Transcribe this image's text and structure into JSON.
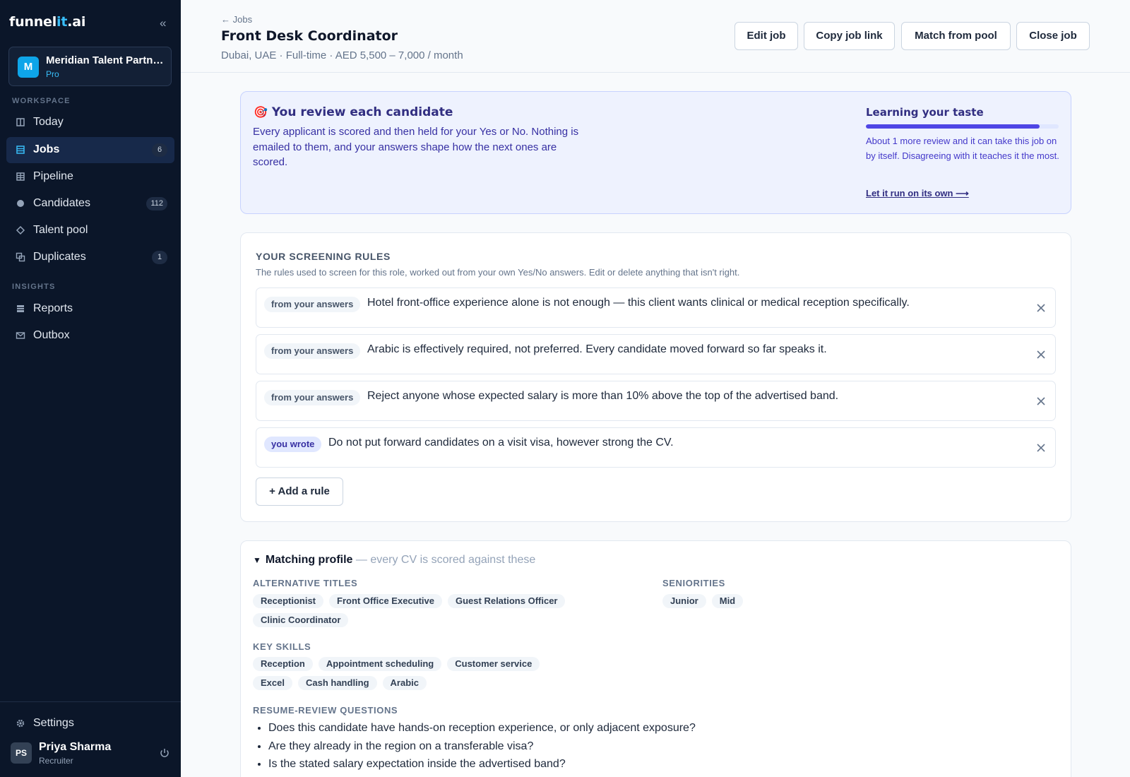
{
  "sidebar": {
    "logo": {
      "part1": "funnel",
      "part2": "it",
      "part3": ".ai"
    },
    "org": {
      "initial": "M",
      "name": "Meridian Talent Partners",
      "plan": "Pro"
    },
    "sections": {
      "workspace": "WORKSPACE",
      "insights": "INSIGHTS"
    },
    "items": [
      {
        "label": "Today",
        "icon": "today-icon"
      },
      {
        "label": "Jobs",
        "icon": "jobs-icon",
        "count": "6",
        "active": true
      },
      {
        "label": "Pipeline",
        "icon": "pipeline-icon"
      },
      {
        "label": "Candidates",
        "icon": "candidates-icon",
        "count": "112"
      },
      {
        "label": "Talent pool",
        "icon": "talent-pool-icon"
      },
      {
        "label": "Duplicates",
        "icon": "duplicates-icon",
        "count": "1"
      },
      {
        "label": "Reports",
        "icon": "reports-icon"
      },
      {
        "label": "Outbox",
        "icon": "outbox-icon"
      }
    ],
    "settings": "Settings",
    "user": {
      "initials": "PS",
      "name": "Priya Sharma",
      "role": "Recruiter"
    }
  },
  "header": {
    "breadcrumb": "← Jobs",
    "title": "Front Desk Coordinator",
    "subtitle": "Dubai, UAE · Full-time · AED 5,500 – 7,000 / month",
    "buttons": {
      "edit": "Edit job",
      "copy": "Copy job link",
      "match": "Match from pool",
      "close": "Close job"
    }
  },
  "banner": {
    "emoji": "🎯",
    "title": "You review each candidate",
    "text": "Every applicant is scored and then held for your Yes or No. Nothing is emailed to them, and your answers shape how the next ones are scored.",
    "learning_title": "Learning your taste",
    "learning_progress": 0.9,
    "learning_text": "About 1 more review and it can take this job on by itself. Disagreeing with it teaches it the most.",
    "learning_link": "Let it run on its own ⟶"
  },
  "rules": {
    "title": "YOUR SCREENING RULES",
    "description": "The rules used to screen for this role, worked out from your own Yes/No answers. Edit or delete anything that isn't right.",
    "items": [
      {
        "tag": "from your answers",
        "text": "Hotel front-office experience alone is not enough — this client wants clinical or medical reception specifically."
      },
      {
        "tag": "from your answers",
        "text": "Arabic is effectively required, not preferred. Every candidate moved forward so far speaks it."
      },
      {
        "tag": "from your answers",
        "text": "Reject anyone whose expected salary is more than 10% above the top of the advertised band."
      },
      {
        "tag": "you wrote",
        "text": "Do not put forward candidates on a visit visa, however strong the CV."
      }
    ],
    "add_label": "+ Add a rule"
  },
  "profile": {
    "toggle": "▼",
    "heading": "Matching profile",
    "heading_suffix": " — every CV is scored against these",
    "alt_titles_label": "ALTERNATIVE TITLES",
    "alt_titles": [
      "Receptionist",
      "Front Office Executive",
      "Guest Relations Officer",
      "Clinic Coordinator"
    ],
    "seniorities_label": "SENIORITIES",
    "seniorities": [
      "Junior",
      "Mid"
    ],
    "skills_label": "KEY SKILLS",
    "skills": [
      "Reception",
      "Appointment scheduling",
      "Customer service",
      "Excel",
      "Cash handling",
      "Arabic"
    ],
    "questions_label": "RESUME-REVIEW QUESTIONS",
    "questions": [
      "Does this candidate have hands-on reception experience, or only adjacent exposure?",
      "Are they already in the region on a transferable visa?",
      "Is the stated salary expectation inside the advertised band?"
    ]
  },
  "colors": {
    "sidebar_bg": "#0b1629",
    "accent": "#4f46e5",
    "logo_accent": "#38bdf8",
    "banner_bg": "#eef2fe"
  }
}
